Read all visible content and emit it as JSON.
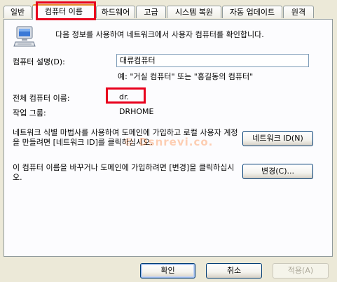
{
  "tabs": [
    {
      "label": "일반"
    },
    {
      "label": "컴퓨터 이름"
    },
    {
      "label": "하드웨어"
    },
    {
      "label": "고급"
    },
    {
      "label": "시스템 복원"
    },
    {
      "label": "자동 업데이트"
    },
    {
      "label": "원격"
    }
  ],
  "active_tab": 1,
  "intro_text": "다음 정보를 사용하여 네트워크에서 사용자 컴퓨터를 확인합니다.",
  "description_label": "컴퓨터 설명(D):",
  "description_value": "대류컴퓨터",
  "description_example": "예: \"거실 컴퓨터\" 또는 \"홍길동의 컴퓨터\"",
  "full_name_label": "전체 컴퓨터 이름:",
  "full_name_value": "dr.",
  "workgroup_label": "작업 그룹:",
  "workgroup_value": "DRHOME",
  "network_text": "네트워크 식별 마법사를 사용하여 도메인에 가입하고 로컬 사용자 계정을 만들려면 [네트워크 ID]를 클릭하십시오.",
  "network_id_button": "네트워크 ID(N)",
  "rename_text": "이 컴퓨터 이름을 바꾸거나 도메인에 가입하려면 [변경]을 클릭하십시오.",
  "change_button": "변경(C)...",
  "ok_button": "확인",
  "cancel_button": "취소",
  "apply_button": "적용(A)",
  "watermark": "© Dsnrevi.co.",
  "colors": {
    "highlight": "#e8001c",
    "tab_accent": "#e68b2c",
    "background": "#ece9d8"
  }
}
